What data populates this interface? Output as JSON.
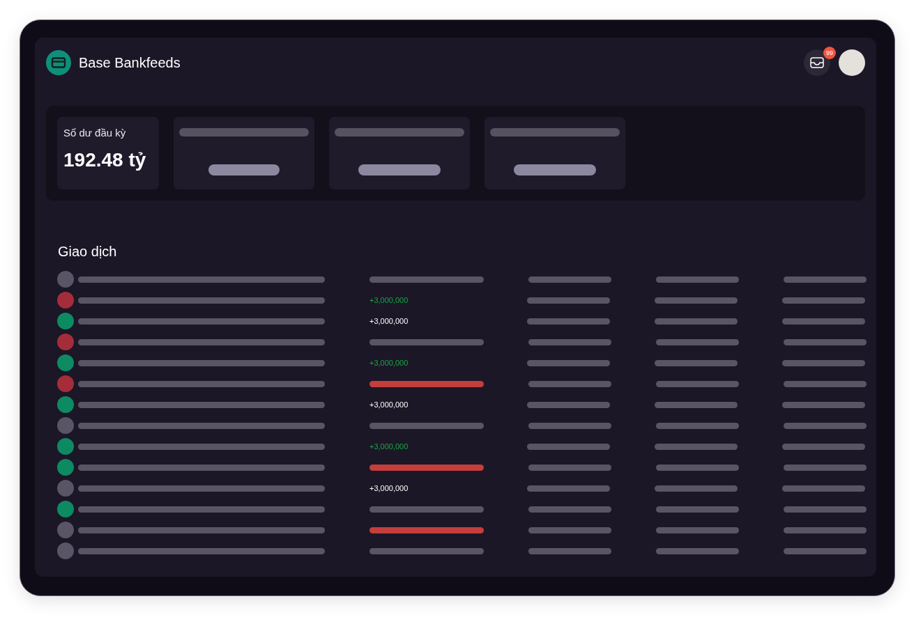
{
  "app": {
    "title": "Base Bankfeeds"
  },
  "notifications": {
    "badge": "99"
  },
  "summary_cards": [
    {
      "kind": "metric",
      "label": "Số dư đầu kỳ",
      "value": "192.48 tỷ"
    },
    {
      "kind": "loading"
    },
    {
      "kind": "loading"
    },
    {
      "kind": "loading"
    }
  ],
  "transactions": {
    "title": "Giao dịch",
    "rows": [
      {
        "color": "#5a5566",
        "amount": {
          "kind": "skeleton"
        }
      },
      {
        "color": "#a52d3b",
        "amount": {
          "kind": "text",
          "text": "+3,000,000",
          "color": "#1aa548"
        }
      },
      {
        "color": "#0e8a63",
        "amount": {
          "kind": "text",
          "text": "+3,000,000",
          "color": "#ffffff"
        }
      },
      {
        "color": "#a52d3b",
        "amount": {
          "kind": "skeleton"
        }
      },
      {
        "color": "#0e8a63",
        "amount": {
          "kind": "text",
          "text": "+3,000,000",
          "color": "#1aa548"
        }
      },
      {
        "color": "#a52d3b",
        "amount": {
          "kind": "flagged"
        }
      },
      {
        "color": "#0e8a63",
        "amount": {
          "kind": "text",
          "text": "+3,000,000",
          "color": "#ffffff"
        }
      },
      {
        "color": "#5a5566",
        "amount": {
          "kind": "skeleton"
        }
      },
      {
        "color": "#0e8a63",
        "amount": {
          "kind": "text",
          "text": "+3,000,000",
          "color": "#1aa548"
        }
      },
      {
        "color": "#0e8a63",
        "amount": {
          "kind": "flagged"
        }
      },
      {
        "color": "#5a5566",
        "amount": {
          "kind": "text",
          "text": "+3,000,000",
          "color": "#ffffff"
        }
      },
      {
        "color": "#0e8a63",
        "amount": {
          "kind": "skeleton"
        }
      },
      {
        "color": "#5a5566",
        "amount": {
          "kind": "flagged"
        }
      },
      {
        "color": "#5a5566",
        "amount": {
          "kind": "skeleton"
        }
      }
    ]
  }
}
